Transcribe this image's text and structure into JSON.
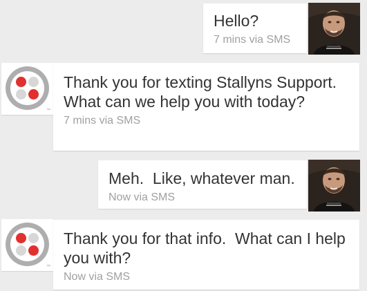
{
  "conversation": {
    "messages": [
      {
        "sender": "user",
        "text": "Hello?",
        "meta": "7 mins via SMS",
        "avatar": "user-photo"
      },
      {
        "sender": "support",
        "text": "Thank you for texting Stallyns Support. What can we help you with today?",
        "meta": "7 mins via SMS",
        "avatar": "stallyns-logo"
      },
      {
        "sender": "user",
        "text": "Meh.  Like, whatever man.",
        "meta": "Now via SMS",
        "avatar": "user-photo"
      },
      {
        "sender": "support",
        "text": "Thank you for that info.  What can I help you with?",
        "meta": "Now via SMS",
        "avatar": "stallyns-logo"
      }
    ]
  },
  "logo": {
    "mark": "™",
    "ring_color": "#aeaeae",
    "red_color": "#e0312f",
    "gray_color": "#d7d7d7"
  },
  "colors": {
    "background": "#ececec",
    "bubble": "#ffffff",
    "text": "#333333",
    "meta": "#a0a0a0"
  }
}
